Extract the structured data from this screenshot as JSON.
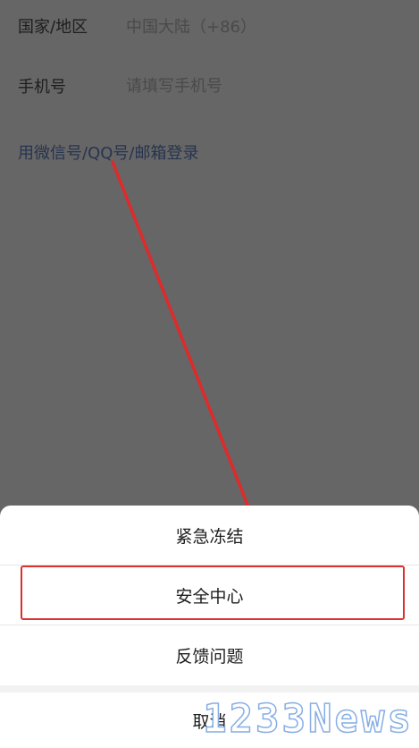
{
  "login_form": {
    "country_label": "国家/地区",
    "country_value": "中国大陆（+86）",
    "phone_label": "手机号",
    "phone_placeholder": "请填写手机号",
    "alt_login_link": "用微信号/QQ号/邮箱登录"
  },
  "action_sheet": {
    "items": [
      {
        "label": "紧急冻结"
      },
      {
        "label": "安全中心",
        "highlighted": true
      },
      {
        "label": "反馈问题"
      }
    ],
    "cancel_label": "取消"
  },
  "annotation": {
    "arrow_color": "#e02a2a",
    "highlight_color": "#dc2f2f"
  },
  "watermark": {
    "text": "1233News"
  }
}
